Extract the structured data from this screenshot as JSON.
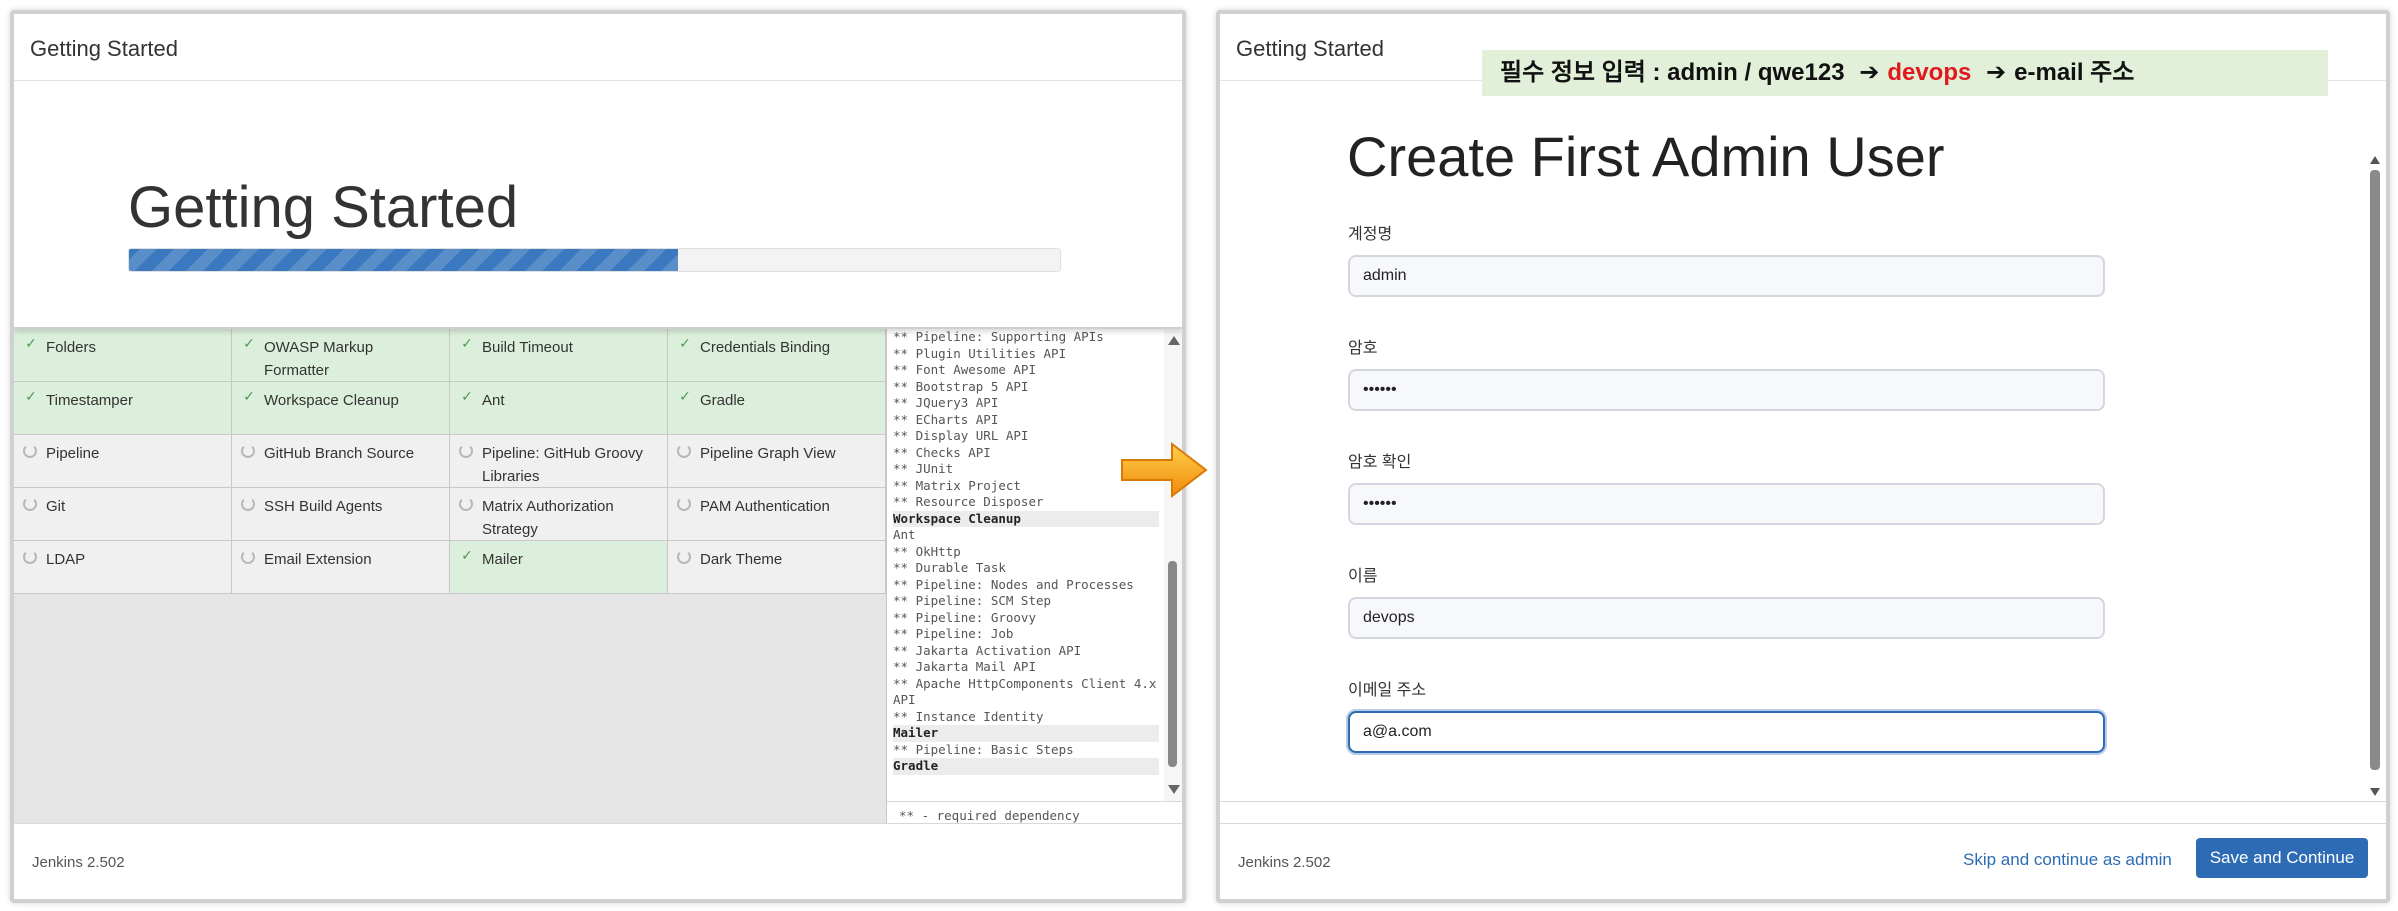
{
  "left": {
    "header_title": "Getting Started",
    "hero_title": "Getting Started",
    "progress_percent": 59,
    "plugins": [
      {
        "name": "Folders",
        "status": "success"
      },
      {
        "name": "OWASP Markup Formatter",
        "status": "success"
      },
      {
        "name": "Build Timeout",
        "status": "success"
      },
      {
        "name": "Credentials Binding",
        "status": "success"
      },
      {
        "name": "Timestamper",
        "status": "success"
      },
      {
        "name": "Workspace Cleanup",
        "status": "success"
      },
      {
        "name": "Ant",
        "status": "success"
      },
      {
        "name": "Gradle",
        "status": "success"
      },
      {
        "name": "Pipeline",
        "status": "pending"
      },
      {
        "name": "GitHub Branch Source",
        "status": "pending"
      },
      {
        "name": "Pipeline: GitHub Groovy Libraries",
        "status": "pending"
      },
      {
        "name": "Pipeline Graph View",
        "status": "pending"
      },
      {
        "name": "Git",
        "status": "pending"
      },
      {
        "name": "SSH Build Agents",
        "status": "pending"
      },
      {
        "name": "Matrix Authorization Strategy",
        "status": "pending"
      },
      {
        "name": "PAM Authentication",
        "status": "pending"
      },
      {
        "name": "LDAP",
        "status": "pending"
      },
      {
        "name": "Email Extension",
        "status": "pending"
      },
      {
        "name": "Mailer",
        "status": "success"
      },
      {
        "name": "Dark Theme",
        "status": "pending"
      }
    ],
    "log_lines": [
      {
        "text": "** Pipeline: Supporting APIs",
        "header": false
      },
      {
        "text": "** Plugin Utilities API",
        "header": false
      },
      {
        "text": "** Font Awesome API",
        "header": false
      },
      {
        "text": "** Bootstrap 5 API",
        "header": false
      },
      {
        "text": "** JQuery3 API",
        "header": false
      },
      {
        "text": "** ECharts API",
        "header": false
      },
      {
        "text": "** Display URL API",
        "header": false
      },
      {
        "text": "** Checks API",
        "header": false
      },
      {
        "text": "** JUnit",
        "header": false
      },
      {
        "text": "** Matrix Project",
        "header": false
      },
      {
        "text": "** Resource Disposer",
        "header": false
      },
      {
        "text": "Workspace Cleanup",
        "header": true
      },
      {
        "text": "Ant",
        "header": false
      },
      {
        "text": "** OkHttp",
        "header": false
      },
      {
        "text": "** Durable Task",
        "header": false
      },
      {
        "text": "** Pipeline: Nodes and Processes",
        "header": false
      },
      {
        "text": "** Pipeline: SCM Step",
        "header": false
      },
      {
        "text": "** Pipeline: Groovy",
        "header": false
      },
      {
        "text": "** Pipeline: Job",
        "header": false
      },
      {
        "text": "** Jakarta Activation API",
        "header": false
      },
      {
        "text": "** Jakarta Mail API",
        "header": false
      },
      {
        "text": "** Apache HttpComponents Client 4.x",
        "header": false
      },
      {
        "text": "API",
        "header": false
      },
      {
        "text": "** Instance Identity",
        "header": false
      },
      {
        "text": "Mailer",
        "header": true
      },
      {
        "text": "** Pipeline: Basic Steps",
        "header": false
      },
      {
        "text": "Gradle",
        "header": true
      }
    ],
    "log_footer": "** - required dependency",
    "version": "Jenkins 2.502"
  },
  "banner": {
    "prefix": "필수 정보 입력 :  admin / qwe123",
    "arrow1": "➔",
    "accent": "devops",
    "arrow2": "➔",
    "suffix": "e-mail 주소"
  },
  "right": {
    "header_title": "Getting Started",
    "form_title": "Create First Admin User",
    "fields": {
      "username": {
        "label": "계정명",
        "value": "admin"
      },
      "password": {
        "label": "암호",
        "value": "••••••"
      },
      "confirm": {
        "label": "암호 확인",
        "value": "••••••"
      },
      "fullname": {
        "label": "이름",
        "value": "devops"
      },
      "email": {
        "label": "이메일 주소",
        "value": "a@a.com"
      }
    },
    "version": "Jenkins 2.502",
    "skip_label": "Skip and continue as admin",
    "save_label": "Save and Continue"
  },
  "colors": {
    "accent_blue": "#2d6bb5",
    "success_green": "#dcefdc",
    "banner_green": "#e2f0d9",
    "banner_red": "#e0191f",
    "arrow_orange": "#f5a21b"
  }
}
